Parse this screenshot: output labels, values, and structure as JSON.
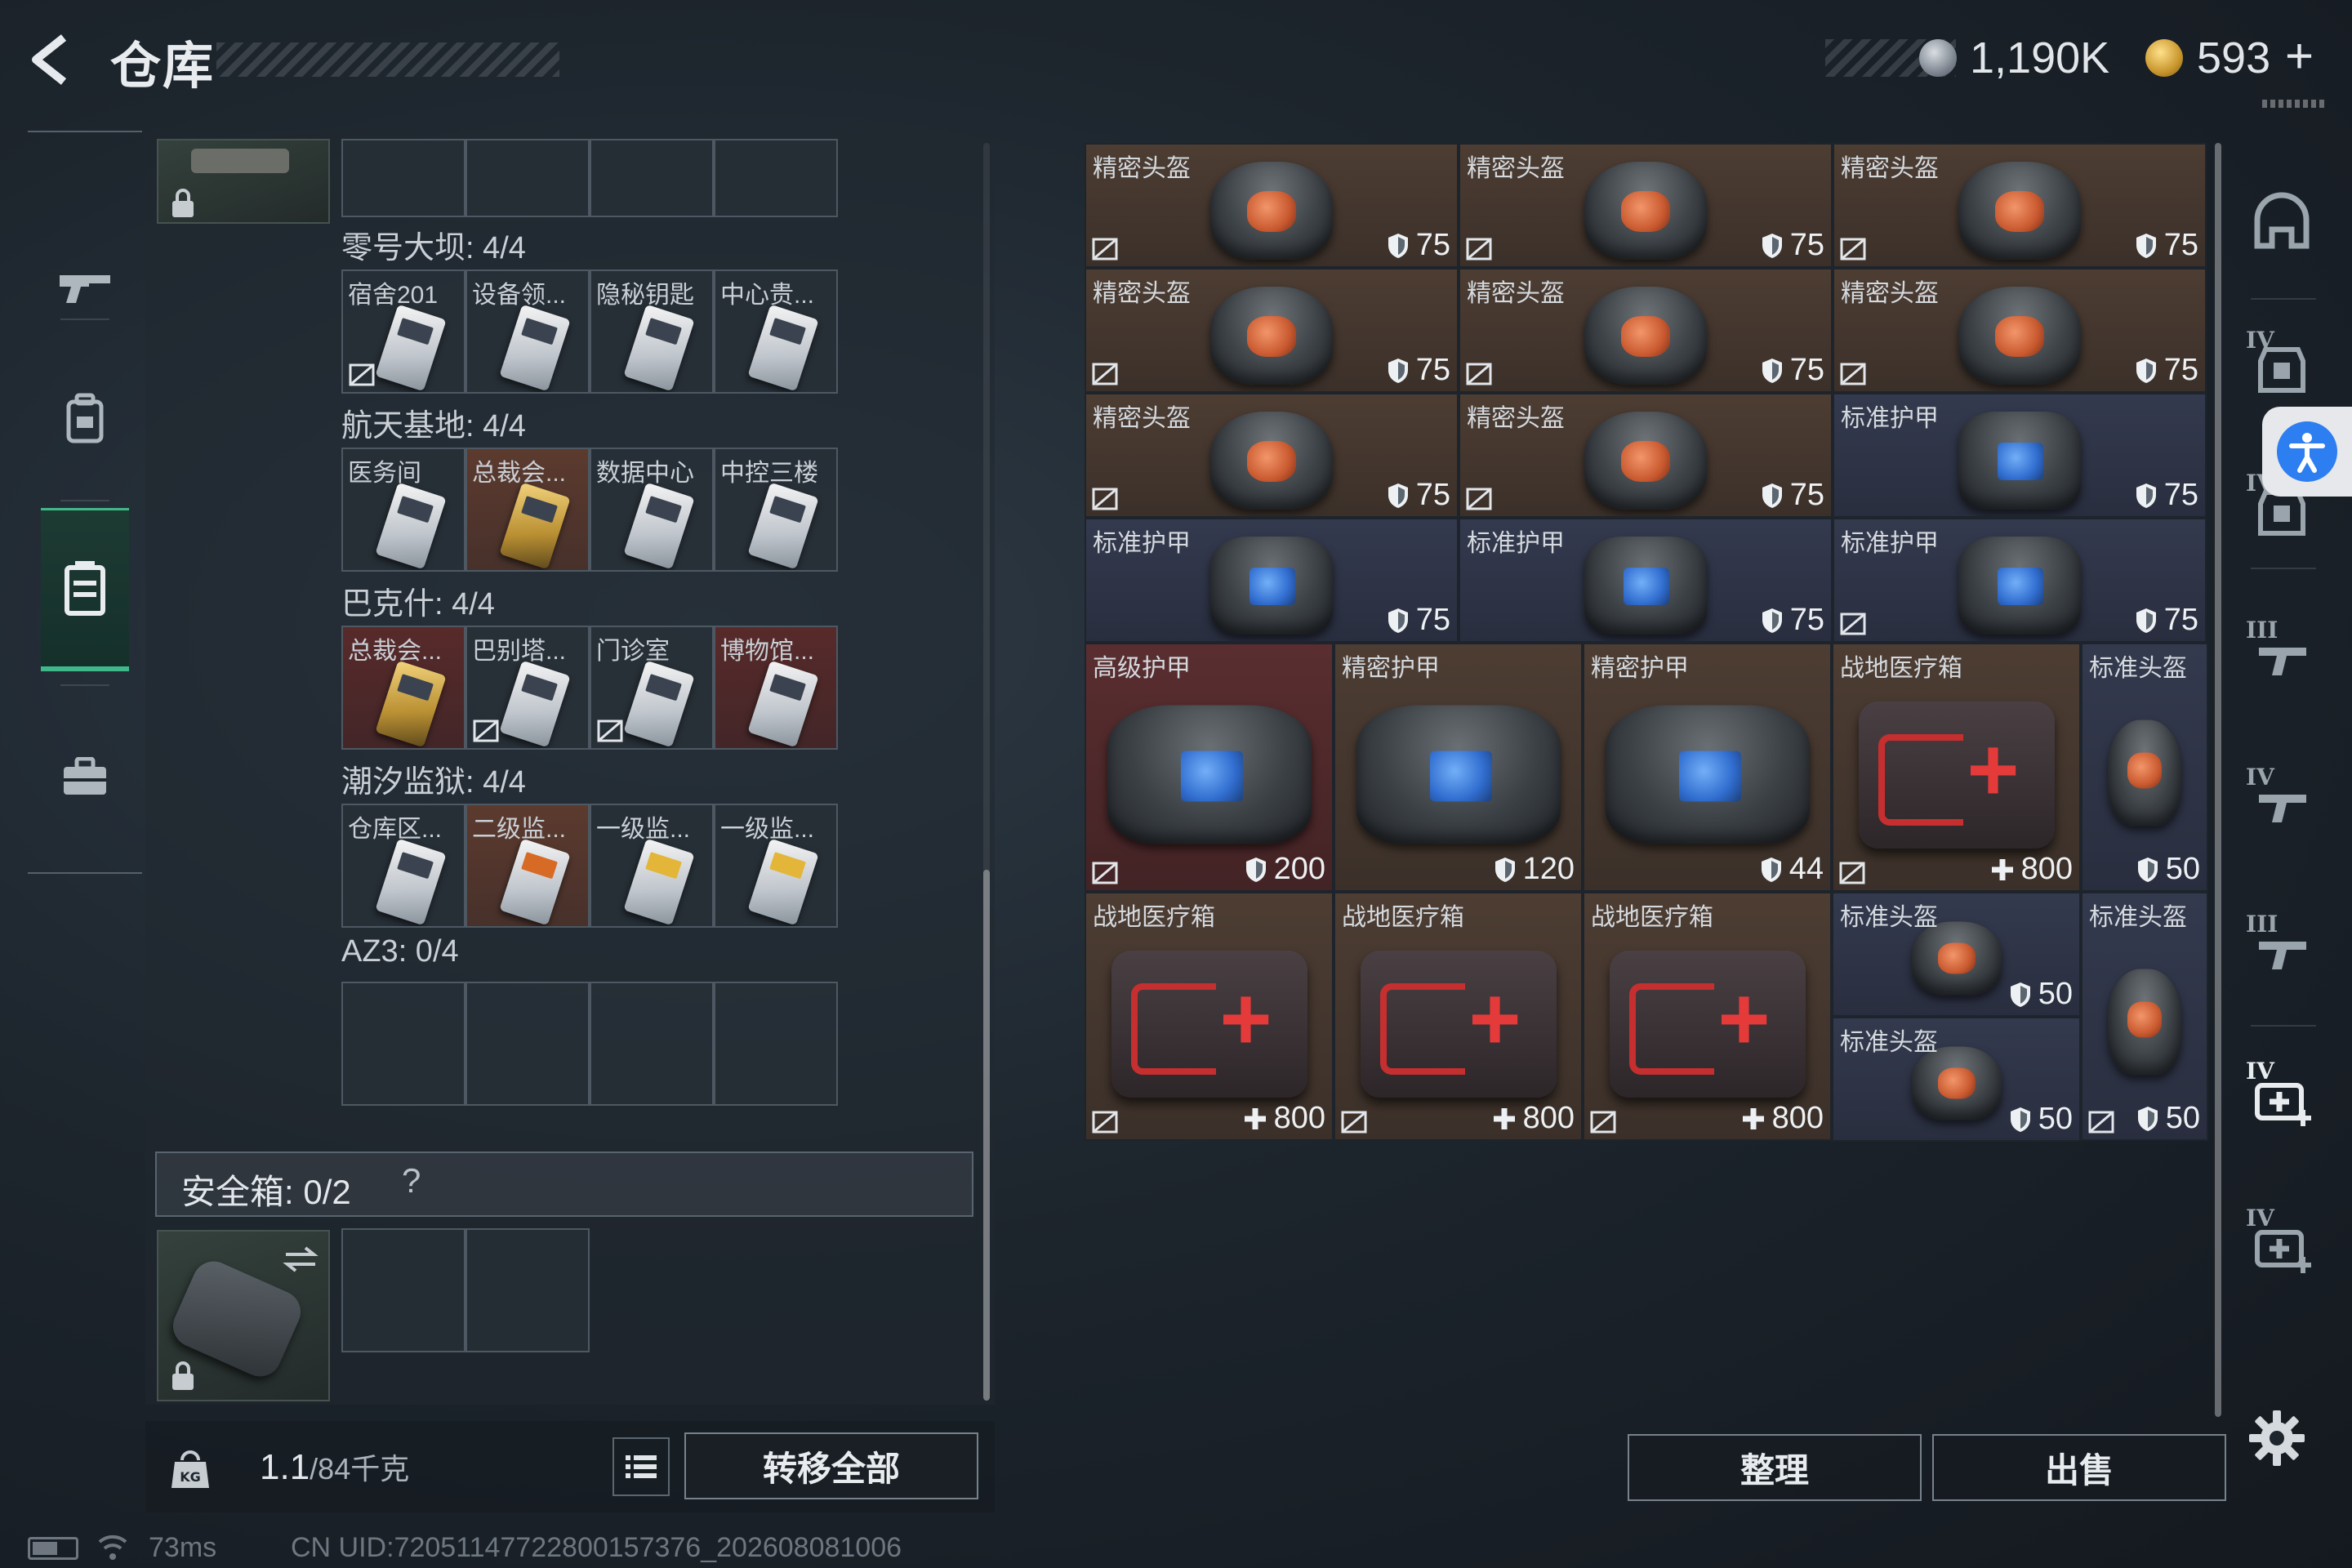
{
  "header": {
    "title": "仓库"
  },
  "currency": [
    {
      "icon": "silver-coin-icon",
      "value": "1,190K"
    },
    {
      "icon": "gold-coin-icon",
      "value": "593"
    }
  ],
  "currency_plus": "+",
  "left_nav": [
    {
      "icon": "gun-icon",
      "active": false
    },
    {
      "icon": "backpack-icon",
      "active": false
    },
    {
      "icon": "locker-icon",
      "active": true
    },
    {
      "icon": "briefcase-icon",
      "active": false
    }
  ],
  "keycard_sections": [
    {
      "label": "零号大坝: 4/4",
      "cards": [
        {
          "label": "宿舍201",
          "bg": "gray",
          "nodrop": true
        },
        {
          "label": "设备领...",
          "bg": "gray",
          "nodrop": false
        },
        {
          "label": "隐秘钥匙",
          "bg": "gray",
          "nodrop": false
        },
        {
          "label": "中心贵...",
          "bg": "gray",
          "nodrop": false
        }
      ]
    },
    {
      "label": "航天基地: 4/4",
      "cards": [
        {
          "label": "医务间",
          "bg": "gray",
          "nodrop": false
        },
        {
          "label": "总裁会...",
          "bg": "gold",
          "nodrop": false
        },
        {
          "label": "数据中心",
          "bg": "gray",
          "nodrop": false
        },
        {
          "label": "中控三楼",
          "bg": "gray",
          "nodrop": false
        }
      ]
    },
    {
      "label": "巴克什: 4/4",
      "cards": [
        {
          "label": "总裁会...",
          "bg": "red",
          "nodrop": false
        },
        {
          "label": "巴别塔...",
          "bg": "gray",
          "nodrop": true
        },
        {
          "label": "门诊室",
          "bg": "gray",
          "nodrop": true
        },
        {
          "label": "博物馆...",
          "bg": "red",
          "nodrop": false
        }
      ]
    },
    {
      "label": "潮汐监狱: 4/4",
      "cards": [
        {
          "label": "仓库区...",
          "bg": "gray",
          "nodrop": false
        },
        {
          "label": "二级监...",
          "bg": "gold",
          "nodrop": false
        },
        {
          "label": "一级监...",
          "bg": "gray",
          "nodrop": false
        },
        {
          "label": "一级监...",
          "bg": "gray",
          "nodrop": false
        }
      ]
    },
    {
      "label": "AZ3: 0/4",
      "cards": []
    }
  ],
  "safe_box": {
    "label": "安全箱: 0/2",
    "help": "?"
  },
  "weight": {
    "value": "1.1",
    "max": "/84",
    "unit": "千克"
  },
  "buttons": {
    "transfer_all": "转移全部",
    "sort": "整理",
    "sell": "出售"
  },
  "stash_items": [
    {
      "name": "精密头盔",
      "type": "helmet",
      "bg": "brown",
      "value": "75",
      "stat": "armor",
      "nodrop": true
    },
    {
      "name": "精密头盔",
      "type": "helmet",
      "bg": "brown",
      "value": "75",
      "stat": "armor",
      "nodrop": true
    },
    {
      "name": "精密头盔",
      "type": "helmet",
      "bg": "brown",
      "value": "75",
      "stat": "armor",
      "nodrop": true
    },
    {
      "name": "精密头盔",
      "type": "helmet",
      "bg": "brown",
      "value": "75",
      "stat": "armor",
      "nodrop": true
    },
    {
      "name": "精密头盔",
      "type": "helmet",
      "bg": "brown",
      "value": "75",
      "stat": "armor",
      "nodrop": true
    },
    {
      "name": "精密头盔",
      "type": "helmet",
      "bg": "brown",
      "value": "75",
      "stat": "armor",
      "nodrop": true
    },
    {
      "name": "精密头盔",
      "type": "helmet",
      "bg": "brown",
      "value": "75",
      "stat": "armor",
      "nodrop": true
    },
    {
      "name": "精密头盔",
      "type": "helmet",
      "bg": "brown",
      "value": "75",
      "stat": "armor",
      "nodrop": true
    },
    {
      "name": "标准护甲",
      "type": "armor",
      "bg": "blue",
      "value": "75",
      "stat": "armor",
      "nodrop": false
    },
    {
      "name": "标准护甲",
      "type": "armor",
      "bg": "blue",
      "value": "75",
      "stat": "armor",
      "nodrop": false
    },
    {
      "name": "标准护甲",
      "type": "armor",
      "bg": "blue",
      "value": "75",
      "stat": "armor",
      "nodrop": false
    },
    {
      "name": "标准护甲",
      "type": "armor",
      "bg": "blue",
      "value": "75",
      "stat": "armor",
      "nodrop": true
    },
    {
      "name": "高级护甲",
      "type": "armor-big",
      "bg": "red",
      "value": "200",
      "stat": "armor",
      "nodrop": true
    },
    {
      "name": "精密护甲",
      "type": "armor-big",
      "bg": "brown",
      "value": "120",
      "stat": "armor",
      "nodrop": false
    },
    {
      "name": "精密护甲",
      "type": "armor-big",
      "bg": "brown",
      "value": "44",
      "stat": "armor",
      "nodrop": false
    },
    {
      "name": "战地医疗箱",
      "type": "medkit",
      "bg": "brown",
      "value": "800",
      "stat": "heal",
      "nodrop": true
    },
    {
      "name": "标准头盔",
      "type": "helmet-tall",
      "bg": "blue",
      "value": "50",
      "stat": "armor",
      "nodrop": false
    },
    {
      "name": "战地医疗箱",
      "type": "medkit",
      "bg": "brown",
      "value": "800",
      "stat": "heal",
      "nodrop": true
    },
    {
      "name": "战地医疗箱",
      "type": "medkit",
      "bg": "brown",
      "value": "800",
      "stat": "heal",
      "nodrop": true
    },
    {
      "name": "战地医疗箱",
      "type": "medkit",
      "bg": "brown",
      "value": "800",
      "stat": "heal",
      "nodrop": true
    },
    {
      "name": "标准头盔",
      "type": "helmet-small",
      "bg": "blue",
      "value": "50",
      "stat": "armor",
      "nodrop": false
    },
    {
      "name": "标准头盔",
      "type": "helmet-small",
      "bg": "blue",
      "value": "50",
      "stat": "armor",
      "nodrop": false
    },
    {
      "name": "标准头盔",
      "type": "helmet-tall",
      "bg": "blue",
      "value": "50",
      "stat": "armor",
      "nodrop": true
    }
  ],
  "right_rail": [
    {
      "tier": "",
      "icon": "helmet-filter-icon"
    },
    {
      "tier": "IV",
      "icon": "armor-filter-icon"
    },
    {
      "tier": "IV",
      "icon": "armor-filter-icon"
    },
    {
      "tier": "III",
      "icon": "gun-filter-icon"
    },
    {
      "tier": "IV",
      "icon": "gun-filter-icon"
    },
    {
      "tier": "III",
      "icon": "gun-filter-icon"
    },
    {
      "tier": "IV",
      "icon": "medkit-filter-icon"
    },
    {
      "tier": "IV",
      "icon": "medkit-filter-icon"
    }
  ],
  "status": {
    "ping": "73ms",
    "uid": "CN UID:7205114772280015​7376_202608081006"
  }
}
